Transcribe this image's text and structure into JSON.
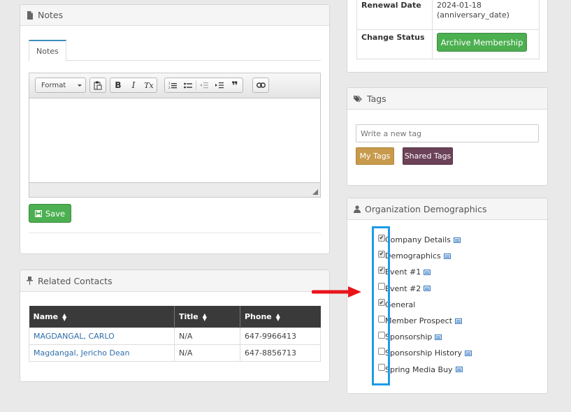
{
  "notes_panel": {
    "title": "Notes",
    "tab_label": "Notes",
    "toolbar": {
      "format_label": "Format",
      "bold": "B",
      "italic": "I",
      "clear_format": "Tx",
      "blockquote": "❞"
    },
    "save_label": "Save"
  },
  "contacts_panel": {
    "title": "Related Contacts",
    "columns": [
      "Name",
      "Title",
      "Phone"
    ],
    "rows": [
      {
        "name": "MAGDANGAL, CARLO",
        "title": "N/A",
        "phone": "647-9966413"
      },
      {
        "name": "Magdangal, Jericho Dean",
        "title": "N/A",
        "phone": "647-8856713"
      }
    ]
  },
  "membership": {
    "renewal_label": "Renewal Date",
    "renewal_date": "2024-01-18",
    "renewal_note": "(anniversary_date)",
    "change_status_label": "Change Status",
    "archive_button": "Archive Membership"
  },
  "tags_panel": {
    "title": "Tags",
    "input_placeholder": "Write a new tag",
    "my_tags": "My Tags",
    "shared_tags": "Shared Tags"
  },
  "demographics_panel": {
    "title": "Organization Demographics",
    "items": [
      {
        "label": "Company Details",
        "checked": true
      },
      {
        "label": "Demographics",
        "checked": true
      },
      {
        "label": "Event #1",
        "checked": true
      },
      {
        "label": "Event #2",
        "checked": false
      },
      {
        "label": "General",
        "checked": true
      },
      {
        "label": "Member Prospect",
        "checked": false
      },
      {
        "label": "Sponsorship",
        "checked": false
      },
      {
        "label": "Sponsorship History",
        "checked": false
      },
      {
        "label": "Spring Media Buy",
        "checked": false
      }
    ]
  },
  "colors": {
    "save_green": "#4caf50",
    "highlight_blue": "#1e9be8",
    "arrow_red": "#e8141a",
    "my_tags": "#c79a4c",
    "shared_tags": "#6b4258"
  }
}
